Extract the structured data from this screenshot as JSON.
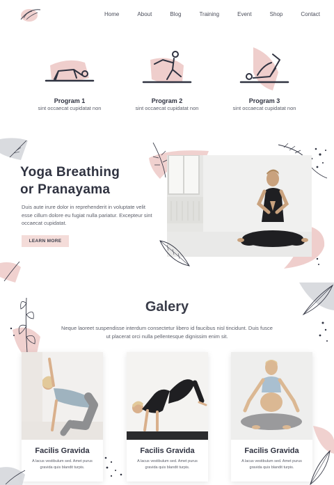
{
  "nav": {
    "items": [
      "Home",
      "About",
      "Blog",
      "Training",
      "Event",
      "Shop",
      "Contact"
    ]
  },
  "programs": [
    {
      "title": "Program 1",
      "subtitle": "sint occaecat cupidatat non",
      "icon": "bridge-pose-icon"
    },
    {
      "title": "Program 2",
      "subtitle": "sint occaecat cupidatat non",
      "icon": "seated-stretch-icon"
    },
    {
      "title": "Program 3",
      "subtitle": "sint occaecat cupidatat non",
      "icon": "reclined-leg-raise-icon"
    }
  ],
  "yoga": {
    "title_line1": "Yoga Breathing",
    "title_line2": "or Pranayama",
    "body": "Duis aute irure dolor in reprehenderit in voluptate velit esse cillum dolore eu fugiat nulla pariatur. Excepteur sint occaecat cupidatat.",
    "button_label": "LEARN MORE"
  },
  "galery": {
    "title": "Galery",
    "text": "Neque laoreet suspendisse interdum consectetur libero id faucibus nisl tincidunt. Duis fusce ut placerat orci nulla pellentesque dignissim enim sit.",
    "cards": [
      {
        "title": "Facilis Gravida",
        "text": "A lacus vestibulum sed. Amet purus gravida quis blandit turpis."
      },
      {
        "title": "Facilis Gravida",
        "text": "A lacus vestibulum sed. Amet purus gravida quis blandit turpis."
      },
      {
        "title": "Facilis Gravida",
        "text": "A lacus vestibulum sed. Amet purus gravida quis blandit turpis."
      }
    ]
  },
  "colors": {
    "accent_pink": "#ecc6c3",
    "button_bg": "#f4dcd9",
    "text_dark": "#2f3240",
    "text_body": "#5a5d68",
    "deco_gray": "#c9ccd2"
  }
}
